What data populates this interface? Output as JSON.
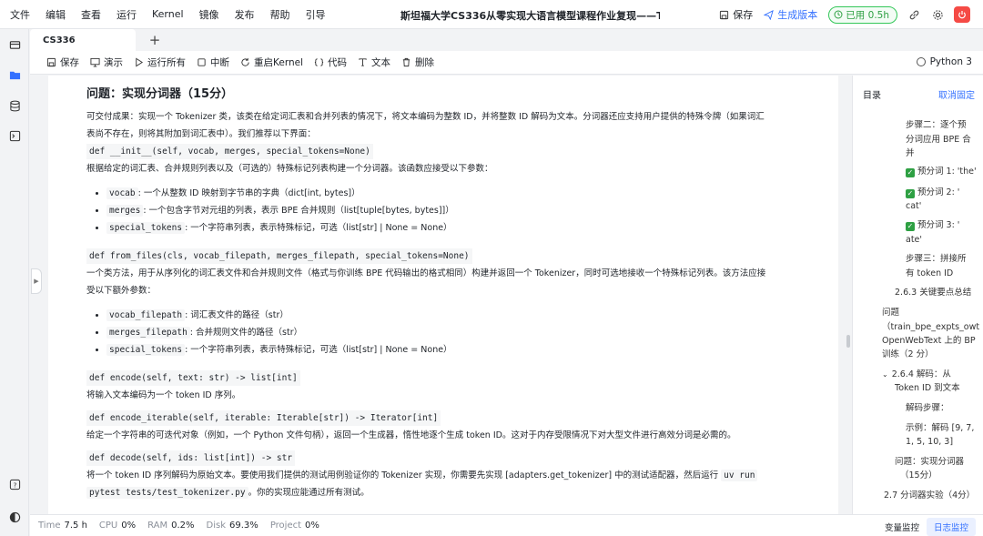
{
  "menu": [
    "文件",
    "编辑",
    "查看",
    "运行",
    "Kernel",
    "镜像",
    "发布",
    "帮助",
    "引导"
  ],
  "doc_title": "斯坦福大学CS336从零实现大语言模型课程作业复现——Toke…",
  "top_actions": {
    "save": "保存",
    "generate": "生成版本",
    "used": "已用 0.5h"
  },
  "tab": {
    "name": "CS336",
    "add": "+"
  },
  "toolbar": {
    "save": "保存",
    "present": "演示",
    "run_all": "运行所有",
    "interrupt": "中断",
    "restart": "重启Kernel",
    "code": "代码",
    "text": "文本",
    "delete": "删除",
    "kernel": "Python 3"
  },
  "cell": {
    "heading": "问题：实现分词器（15分）",
    "intro_a": "可交付成果：实现一个 Tokenizer 类，该类在给定词汇表和合并列表的情况下，将文本编码为整数 ID，并将整数 ID 解码为文本。分词器还应支持用户提供的特殊令牌（如果词汇",
    "intro_b": "表尚不存在，则将其附加到词汇表中）。我们推荐以下界面：",
    "sig_init": "def __init__(self, vocab, merges, special_tokens=None)",
    "desc_init": "根据给定的词汇表、合并规则列表以及（可选的）特殊标记列表构建一个分词器。该函数应接受以下参数：",
    "init_params": [
      {
        "code": "vocab",
        "text": ": 一个从整数 ID 映射到字节串的字典（dict[int, bytes]）"
      },
      {
        "code": "merges",
        "text": ": 一个包含字节对元组的列表，表示 BPE 合并规则（list[tuple[bytes, bytes]]）"
      },
      {
        "code": "special_tokens",
        "text": ": 一个字符串列表，表示特殊标记，可选（list[str] | None = None）"
      }
    ],
    "sig_from_files": "def from_files(cls, vocab_filepath, merges_filepath, special_tokens=None)",
    "desc_from_files_a": "一个类方法，用于从序列化的词汇表文件和合并规则文件（格式与你训练 BPE 代码输出的格式相同）构建并返回一个 Tokenizer，同时可选地接收一个特殊标记列表。该方法应接",
    "desc_from_files_b": "受以下额外参数：",
    "from_files_params": [
      {
        "code": "vocab_filepath",
        "text": ": 词汇表文件的路径（str）"
      },
      {
        "code": "merges_filepath",
        "text": ": 合并规则文件的路径（str）"
      },
      {
        "code": "special_tokens",
        "text": ": 一个字符串列表，表示特殊标记，可选（list[str] | None = None）"
      }
    ],
    "sig_encode": "def encode(self, text: str) -> list[int]",
    "desc_encode": "将输入文本编码为一个 token ID 序列。",
    "sig_encode_iterable": "def encode_iterable(self, iterable: Iterable[str]) -> Iterator[int]",
    "desc_encode_iterable": "给定一个字符串的可迭代对象（例如，一个 Python 文件句柄），返回一个生成器，惰性地逐个生成 token ID。这对于内存受限情况下对大型文件进行高效分词是必需的。",
    "sig_decode": "def decode(self, ids: list[int]) -> str",
    "desc_decode_a": "将一个 token ID 序列解码为原始文本。要使用我们提供的测试用例验证你的 Tokenizer 实现，你需要先实现 [adapters.get_tokenizer] 中的测试适配器，然后运行 ",
    "desc_decode_code1": "uv run",
    "desc_decode_code2": "pytest tests/test_tokenizer.py",
    "desc_decode_b": "。你的实现应能通过所有测试。"
  },
  "toc": {
    "title": "目录",
    "cancel_pin": "取消固定",
    "items": [
      "步骤二：逐个预",
      "分词应用 BPE 合",
      "并",
      "预分词 1: 'the'",
      "预分词 2: '",
      "cat'",
      "预分词 3: '",
      "ate'",
      "步骤三：拼接所",
      "有 token ID",
      "2.6.3 关键要点总结",
      "问题",
      "（train_bpe_expts_owt",
      "OpenWebText 上的 BP",
      "训练（2 分）",
      "2.6.4 解码：从",
      "Token ID 到文本",
      "解码步骤：",
      "示例：解码 [9, 7,",
      "1, 5, 10, 3]",
      "问题：实现分词器",
      "（15分）",
      "2.7 分词器实验（4分）"
    ]
  },
  "status": {
    "time_label": "Time",
    "time_value": "7.5 h",
    "cpu_label": "CPU",
    "cpu_value": "0%",
    "ram_label": "RAM",
    "ram_value": "0.2%",
    "disk_label": "Disk",
    "disk_value": "69.3%",
    "project_label": "Project",
    "project_value": "0%",
    "var_monitor": "变量监控",
    "log_monitor": "日志监控"
  },
  "colors": {
    "accent": "#3370ff",
    "success": "#2ea043",
    "danger": "#f54a45"
  }
}
